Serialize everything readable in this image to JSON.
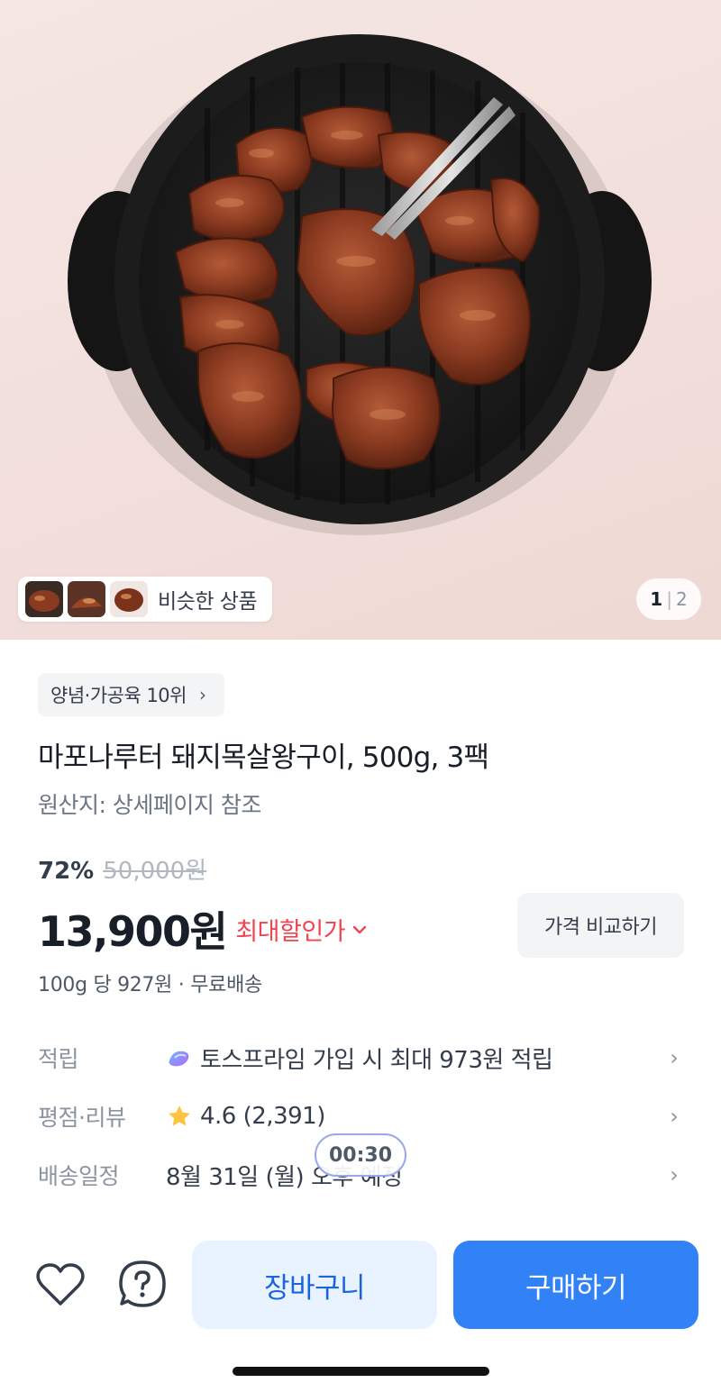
{
  "hero": {
    "similar_label": "비슷한 상품",
    "pager_current": "1",
    "pager_separator": "|",
    "pager_total": "2"
  },
  "product": {
    "rank_chip": "양념·가공육 10위",
    "title": "마포나루터 돼지목살왕구이, 500g, 3팩",
    "origin": "원산지: 상세페이지 참조",
    "discount_rate": "72%",
    "original_price": "50,000원",
    "price": "13,900원",
    "max_discount_label": "최대할인가",
    "compare_button": "가격 비교하기",
    "unit_price_shipping": "100g 당 927원 · 무료배송"
  },
  "info_rows": [
    {
      "key": "적립",
      "value": "토스프라임 가입 시 최대 973원 적립",
      "icon": "toss-prime-icon"
    },
    {
      "key": "평점·리뷰",
      "value": "4.6 (2,391)",
      "icon": "star-icon"
    },
    {
      "key": "배송일정",
      "value": "8월 31일 (월) 오후 예정",
      "icon": ""
    }
  ],
  "timer": "00:30",
  "bottom": {
    "cart_button": "장바구니",
    "buy_button": "구매하기"
  },
  "colors": {
    "accent_blue": "#3182f6",
    "cart_bg": "#e8f3ff",
    "discount_red": "#f04452",
    "star": "#ffc342"
  }
}
